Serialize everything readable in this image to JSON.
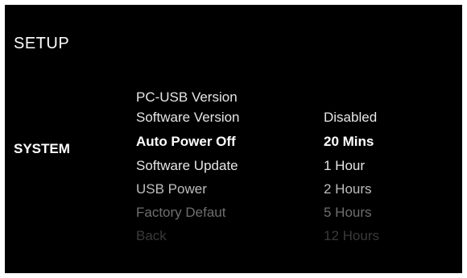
{
  "screen": {
    "title": "SETUP",
    "category": "SYSTEM"
  },
  "menu": {
    "items": [
      "PC-USB Version",
      "Software Version",
      "Auto Power Off",
      "Software Update",
      "USB Power",
      "Factory Defaut",
      "Back"
    ],
    "selected_index": 2
  },
  "values": {
    "options": [
      "Disabled",
      "20 Mins",
      "1 Hour",
      "2 Hours",
      "5 Hours",
      "12 Hours"
    ],
    "selected_index": 1
  }
}
